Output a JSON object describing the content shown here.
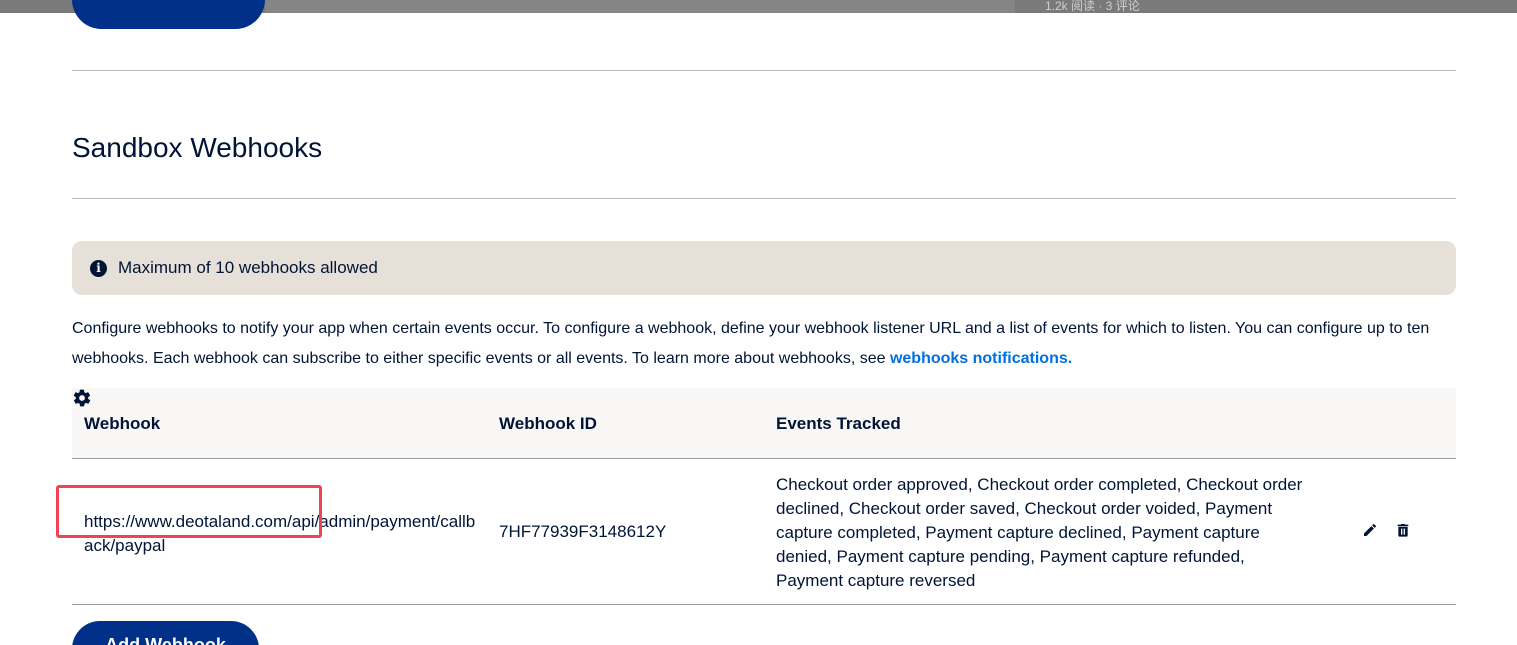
{
  "top_strip": {
    "text": "1.2k 阅读 · 3 评论"
  },
  "top_button": {
    "label": ""
  },
  "section": {
    "title": "Sandbox Webhooks"
  },
  "banner": {
    "icon": "info-icon",
    "text": "Maximum of 10 webhooks allowed"
  },
  "description": {
    "text": "Configure webhooks to notify your app when certain events occur. To configure a webhook, define your webhook listener URL and a list of events for which to listen. You can configure up to ten webhooks. Each webhook can subscribe to either specific events or all events. To learn more about webhooks, see ",
    "link": "webhooks notifications."
  },
  "table": {
    "headers": {
      "webhook": "Webhook",
      "webhook_id": "Webhook ID",
      "events": "Events Tracked",
      "settings_icon": "gear-icon"
    },
    "rows": [
      {
        "url": "https://www.deotaland.com/api/admin/payment/callback/paypal",
        "id": "7HF77939F3148612Y",
        "events": "Checkout order approved, Checkout order completed, Checkout order declined, Checkout order saved, Checkout order voided, Payment capture completed, Payment capture declined, Payment capture denied, Payment capture pending, Payment capture refunded, Payment capture reversed",
        "actions": [
          "pencil-icon",
          "trash-icon"
        ]
      }
    ]
  },
  "add_button": {
    "label": "Add Webhook"
  },
  "colors": {
    "primary": "#003087",
    "link": "#0070e0",
    "banner_bg": "#e6e0d9",
    "highlight": "#ee4454",
    "text": "#001435"
  }
}
